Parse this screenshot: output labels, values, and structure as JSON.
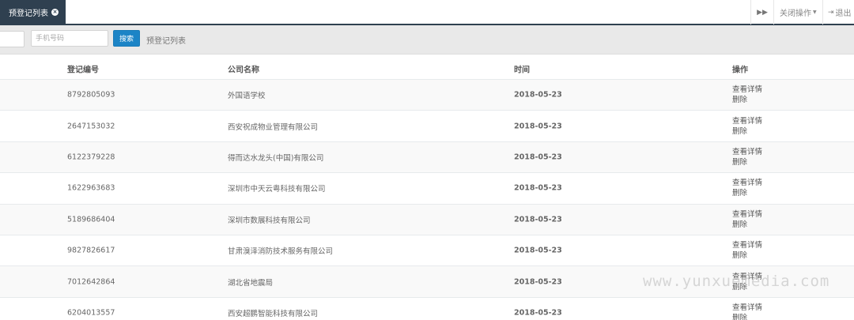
{
  "tabs": {
    "active_label": "预登记列表",
    "close_glyph": "×",
    "forward_glyph": "▶▶",
    "close_ops_label": "关闭操作",
    "exit_label": "退出"
  },
  "search": {
    "phone_placeholder": "手机号码",
    "button_label": "搜索",
    "caption": "预登记列表"
  },
  "table": {
    "headers": [
      "登记编号",
      "公司名称",
      "时间",
      "操作"
    ],
    "rows": [
      {
        "id": "8792805093",
        "company": "外国语学校",
        "date": "2018-05-23",
        "view": "查看详情",
        "delete": "删除"
      },
      {
        "id": "2647153032",
        "company": "西安祝成物业管理有限公司",
        "date": "2018-05-23",
        "view": "查看详情",
        "delete": "删除"
      },
      {
        "id": "6122379228",
        "company": "得而达水龙头(中国)有限公司",
        "date": "2018-05-23",
        "view": "查看详情",
        "delete": "删除"
      },
      {
        "id": "1622963683",
        "company": "深圳市中天云粤科技有限公司",
        "date": "2018-05-23",
        "view": "查看详情",
        "delete": "删除"
      },
      {
        "id": "5189686404",
        "company": "深圳市数展科技有限公司",
        "date": "2018-05-23",
        "view": "查看详情",
        "delete": "删除"
      },
      {
        "id": "9827826617",
        "company": "甘肃溴泽消防技术服务有限公司",
        "date": "2018-05-23",
        "view": "查看详情",
        "delete": "删除"
      },
      {
        "id": "7012642864",
        "company": "湖北省地震局",
        "date": "2018-05-23",
        "view": "查看详情",
        "delete": "删除"
      },
      {
        "id": "6204013557",
        "company": "西安超鹏智能科技有限公司",
        "date": "2018-05-23",
        "view": "查看详情",
        "delete": "删除"
      }
    ]
  },
  "watermark": "www.yunxuemedia.com"
}
